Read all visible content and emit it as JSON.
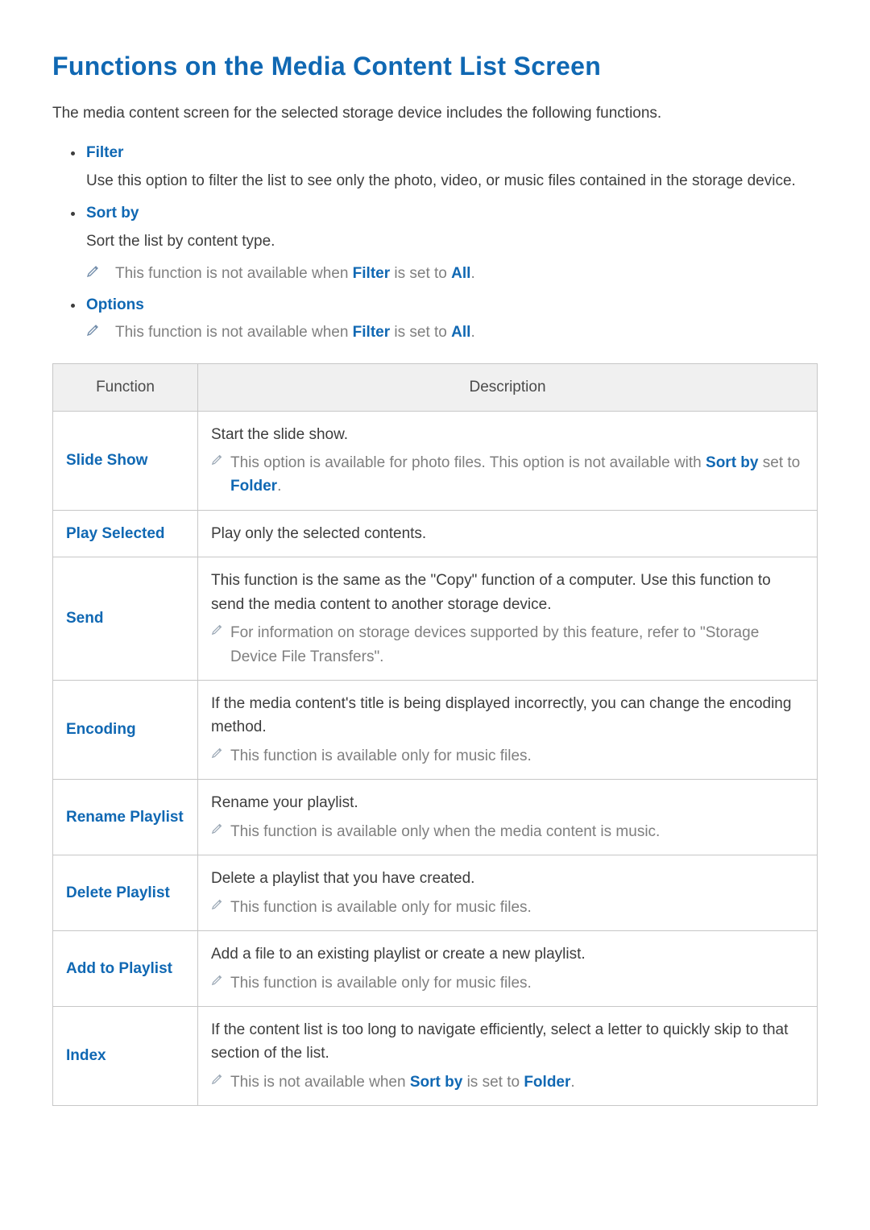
{
  "title": "Functions on the Media Content List Screen",
  "intro": "The media content screen for the selected storage device includes the following functions.",
  "items": [
    {
      "name": "Filter",
      "desc": "Use this option to filter the list to see only the photo, video, or music files contained in the storage device.",
      "notes": []
    },
    {
      "name": "Sort by",
      "desc": "Sort the list by content type.",
      "notes": [
        {
          "pre": "This function is not available when ",
          "k1": "Filter",
          "mid": " is set to ",
          "k2": "All",
          "post": "."
        }
      ]
    },
    {
      "name": "Options",
      "desc": "",
      "notes": [
        {
          "pre": "This function is not available when ",
          "k1": "Filter",
          "mid": " is set to ",
          "k2": "All",
          "post": "."
        }
      ]
    }
  ],
  "table": {
    "headers": {
      "function": "Function",
      "description": "Description"
    },
    "rows": [
      {
        "fn": "Slide Show",
        "desc": "Start the slide show.",
        "note": {
          "pre": "This option is available for photo files. This option is not available with ",
          "k1": "Sort by",
          "mid": " set to ",
          "k2": "Folder",
          "post": "."
        }
      },
      {
        "fn": "Play Selected",
        "desc": "Play only the selected contents.",
        "note": null
      },
      {
        "fn": "Send",
        "desc": "This function is the same as the \"Copy\" function of a computer. Use this function to send the media content to another storage device.",
        "note": {
          "pre": "For information on storage devices supported by this feature, refer to \"Storage Device File Transfers\".",
          "k1": "",
          "mid": "",
          "k2": "",
          "post": ""
        }
      },
      {
        "fn": "Encoding",
        "desc": "If the media content's title is being displayed incorrectly, you can change the encoding method.",
        "note": {
          "pre": "This function is available only for music files.",
          "k1": "",
          "mid": "",
          "k2": "",
          "post": ""
        }
      },
      {
        "fn": "Rename Playlist",
        "desc": "Rename your playlist.",
        "note": {
          "pre": "This function is available only when the media content is music.",
          "k1": "",
          "mid": "",
          "k2": "",
          "post": ""
        }
      },
      {
        "fn": "Delete Playlist",
        "desc": "Delete a playlist that you have created.",
        "note": {
          "pre": "This function is available only for music files.",
          "k1": "",
          "mid": "",
          "k2": "",
          "post": ""
        }
      },
      {
        "fn": "Add to Playlist",
        "desc": "Add a file to an existing playlist or create a new playlist.",
        "note": {
          "pre": "This function is available only for music files.",
          "k1": "",
          "mid": "",
          "k2": "",
          "post": ""
        }
      },
      {
        "fn": "Index",
        "desc": "If the content list is too long to navigate efficiently, select a letter to quickly skip to that section of the list.",
        "note": {
          "pre": "This is not available when ",
          "k1": "Sort by",
          "mid": " is set to ",
          "k2": "Folder",
          "post": "."
        }
      }
    ]
  }
}
